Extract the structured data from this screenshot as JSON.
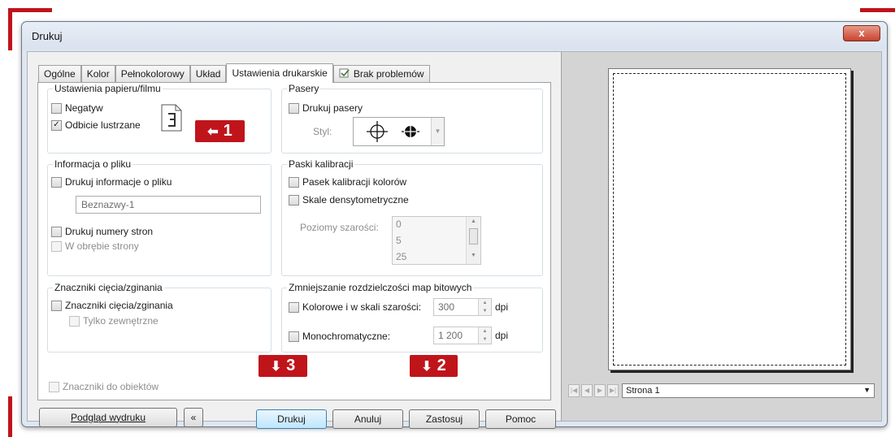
{
  "window": {
    "title": "Drukuj",
    "close_label": "x"
  },
  "tabs": [
    "Ogólne",
    "Kolor",
    "Pełnokolorowy",
    "Układ",
    "Ustawienia drukarskie",
    "Brak problemów"
  ],
  "paper_film": {
    "title": "Ustawienia papieru/filmu",
    "negative": {
      "label": "Negatyw",
      "checked": false
    },
    "mirror": {
      "label": "Odbicie lustrzane",
      "checked": true
    }
  },
  "registration": {
    "title": "Pasery",
    "print": {
      "label": "Drukuj pasery",
      "checked": false
    },
    "style_label": "Styl:"
  },
  "file_info": {
    "title": "Informacja o pliku",
    "print_info": {
      "label": "Drukuj informacje o pliku",
      "checked": false
    },
    "filename": "Beznazwy-1",
    "page_numbers": {
      "label": "Drukuj numery stron",
      "checked": false
    },
    "within_page": {
      "label": "W obrębie strony",
      "checked": false
    }
  },
  "calibration": {
    "title": "Paski kalibracji",
    "color_bar": {
      "label": "Pasek kalibracji kolorów",
      "checked": false
    },
    "densitometer": {
      "label": "Skale densytometryczne",
      "checked": false
    },
    "gray_levels_label": "Poziomy szarości:",
    "gray_levels": [
      "0",
      "5",
      "25"
    ]
  },
  "crop_marks": {
    "title": "Znaczniki cięcia/zginania",
    "marks": {
      "label": "Znaczniki cięcia/zginania",
      "checked": false
    },
    "exterior": {
      "label": "Tylko zewnętrzne",
      "checked": false
    }
  },
  "downsample": {
    "title": "Zmniejszanie rozdzielczości map bitowych",
    "color": {
      "label": "Kolorowe i w skali szarości:",
      "value": "300",
      "unit": "dpi"
    },
    "mono": {
      "label": "Monochromatyczne:",
      "value": "1 200",
      "unit": "dpi"
    }
  },
  "object_marks": {
    "label": "Znaczniki do obiektów",
    "checked": false
  },
  "buttons": {
    "preview": "Podgląd wydruku",
    "collapse_icon": "«",
    "print": "Drukuj",
    "cancel": "Anuluj",
    "apply": "Zastosuj",
    "help": "Pomoc"
  },
  "preview_pane": {
    "page_label": "Strona 1"
  },
  "callouts": {
    "one": {
      "number": "1",
      "arrow": "⬅"
    },
    "two": {
      "number": "2",
      "arrow": "⬇"
    },
    "three": {
      "number": "3",
      "arrow": "⬇"
    }
  },
  "colors": {
    "callout": "#c0141b",
    "window_frame": "#dfe6ef",
    "default_button": "#bee6fd"
  }
}
